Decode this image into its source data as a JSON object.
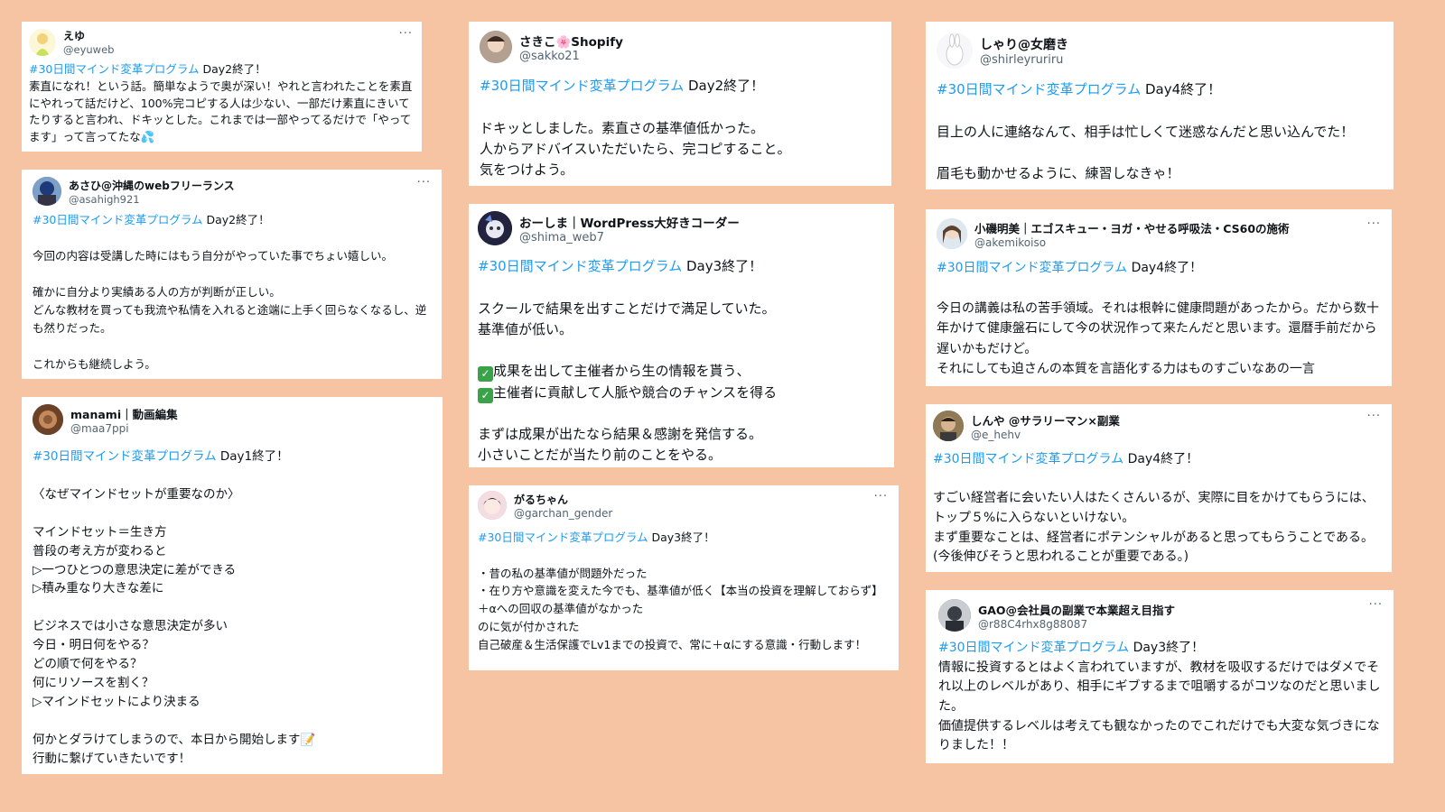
{
  "hashtag": "#30日間マインド変革プログラム",
  "icons": {
    "more": "more-horizontal-icon",
    "check": "check-mark-button-icon"
  },
  "cards": [
    {
      "name": "えゆ",
      "handle": "@eyuweb",
      "day": " Day2終了！",
      "avatar_color": "#c8e26a",
      "avatar_text": "",
      "text": "素直になれ！という話。簡単なようで奥が深い！やれと言われたことを素直にやれって話だけど、100%完コピする人は少ない、一部だけ素直にきいてたりすると言われ、ドキッとした。これまでは一部やってるだけで「やってます」って言ってたな",
      "end_emoji": "💦"
    },
    {
      "name": "あさひ@沖縄のwebフリーランス",
      "handle": "@asahigh921",
      "day": " Day2終了！",
      "avatar_color": "#2b4a88",
      "avatar_text": "",
      "text": "\n今回の内容は受講した時にはもう自分がやっていた事でちょい嬉しい。\n\n確かに自分より実績ある人の方が判断が正しい。\nどんな教材を買っても我流や私情を入れると途端に上手く回らなくなるし、逆も然りだった。\n\nこれからも継続しよう。"
    },
    {
      "name": "manami｜動画編集",
      "handle": "@maa7ppi",
      "day": " Day1終了！",
      "avatar_color": "#8a5a3a",
      "avatar_text": "",
      "text": "\n〈なぜマインドセットが重要なのか〉\n\nマインドセット＝生き方\n普段の考え方が変わると\n▷一つひとつの意思決定に差ができる\n▷積み重なり大きな差に\n\nビジネスでは小さな意思決定が多い\n今日・明日何をやる？\nどの順で何をやる？\n何にリソースを割く？\n▷マインドセットにより決まる\n\n何かとダラけてしまうので、本日から開始します",
      "memo_emoji": "📝",
      "text_after": "\n行動に繋げていきたいです！"
    },
    {
      "name": "さきこ🌸Shopify",
      "handle": "@sakko21",
      "day": " Day2終了！",
      "avatar_color": "#9a8576",
      "avatar_text": "",
      "text": "\nドキッとしました。素直さの基準値低かった。\n人からアドバイスいただいたら、完コピすること。\n気をつけよう。"
    },
    {
      "name": "おーしま｜WordPress大好きコーダー",
      "handle": "@shima_web7",
      "day": " Day3終了！",
      "avatar_color": "#2a2c4a",
      "avatar_text": "",
      "text_a": "\nスクールで結果を出すことだけで満足していた。\n基準値が低い。\n",
      "checks": [
        "成果を出して主催者から生の情報を貰う、",
        "主催者に貢献して人脈や競合のチャンスを得る"
      ],
      "text_b": "\nまずは成果が出たなら結果＆感謝を発信する。\n小さいことだが当たり前のことをやる。"
    },
    {
      "name": "がるちゃん",
      "handle": "@garchan_gender",
      "day": " Day3終了！",
      "avatar_color": "#c98a9a",
      "avatar_text": "",
      "text": "\n・昔の私の基準値が問題外だった\n・在り方や意識を変えた今でも、基準値が低く【本当の投資を理解しておらず】＋αへの回収の基準値がなかった\nのに気が付かされた\n自己破産＆生活保護でLv1までの投資で、常に＋αにする意識・行動します！"
    },
    {
      "name": "しゃり@女磨き",
      "handle": "@shirleyruriru",
      "day": " Day4終了！",
      "avatar_color": "#e8e8ee",
      "avatar_text": "",
      "text": "\n目上の人に連絡なんて、相手は忙しくて迷惑なんだと思い込んでた！\n\n眉毛も動かせるように、練習しなきゃ！"
    },
    {
      "name": "小磯明美｜エゴスキュー・ヨガ・やせる呼吸法・CS60の施術",
      "handle": "@akemikoiso",
      "day": " Day4終了！",
      "avatar_color": "#b9cbdc",
      "avatar_text": "",
      "text": "\n今日の講義は私の苦手領域。それは根幹に健康問題があったから。だから数十年かけて健康盤石にして今の状況作って来たんだと思います。還暦手前だから遅いかもだけど。\nそれにしても迫さんの本質を言語化する力はものすごいなあの一言"
    },
    {
      "name": "しんや @サラリーマン×副業",
      "handle": "@e_hehv",
      "day": " Day4終了！",
      "avatar_color": "#6b5a3a",
      "avatar_text": "",
      "text": "\nすごい経営者に会いたい人はたくさんいるが、実際に目をかけてもらうには、トップ５%に入らないといけない。\nまず重要なことは、経営者にポテンシャルがあると思ってもらうことである。(今後伸びそうと思われることが重要である。)"
    },
    {
      "name": "GAO@会社員の副業で本業超え目指す",
      "handle": "@r88C4rhx8g88087",
      "day": " Day3終了！",
      "avatar_color": "#5a5f66",
      "avatar_text": "",
      "text": "情報に投資するとはよく言われていますが、教材を吸収するだけではダメでそれ以上のレベルがあり、相手にギブするまで咀嚼するがコツなのだと思いました。\n価値提供するレベルは考えても観なかったのでこれだけでも大変な気づきになりました！！"
    }
  ]
}
